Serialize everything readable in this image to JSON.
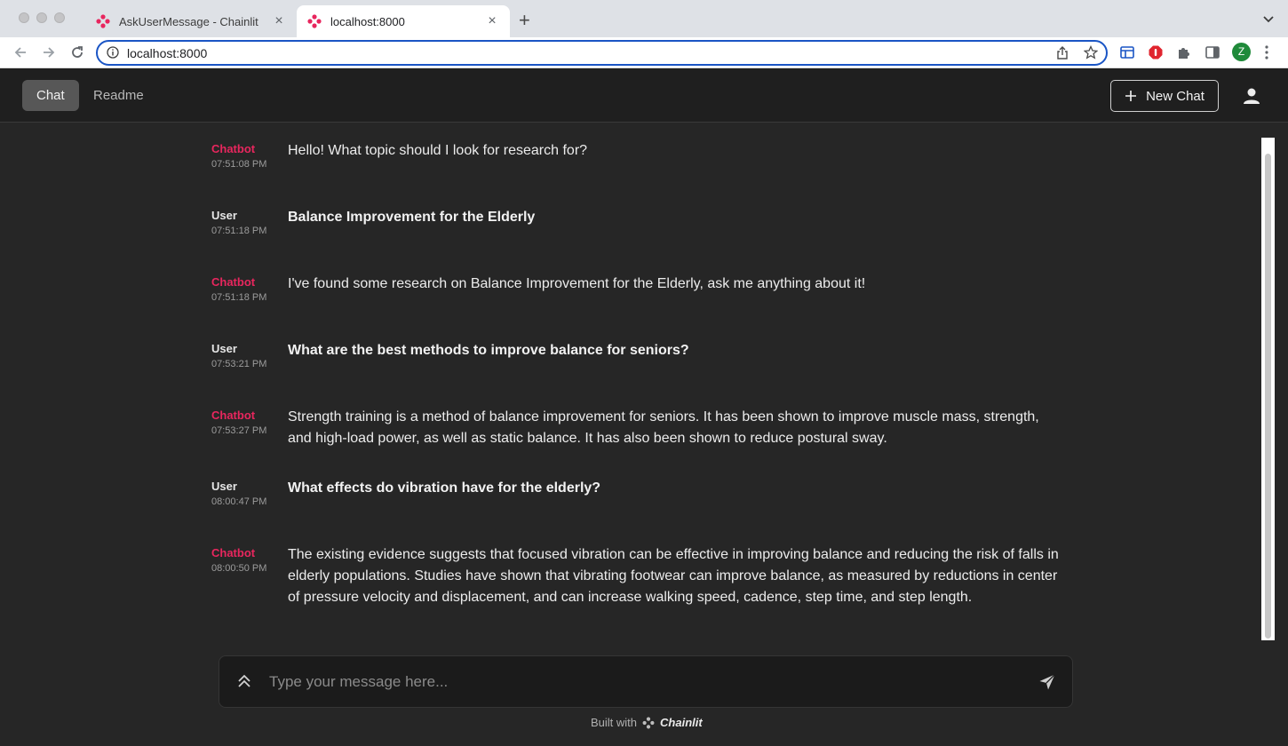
{
  "browser": {
    "tabs": [
      {
        "title": "AskUserMessage - Chainlit",
        "active": false
      },
      {
        "title": "localhost:8000",
        "active": true
      }
    ],
    "url": "localhost:8000",
    "profile_initial": "Z"
  },
  "header": {
    "nav": [
      "Chat",
      "Readme"
    ],
    "new_chat_label": "New Chat"
  },
  "messages": [
    {
      "author": "Chatbot",
      "time": "07:51:08 PM",
      "text": "Hello! What topic should I look for research for?"
    },
    {
      "author": "User",
      "time": "07:51:18 PM",
      "text": "Balance Improvement for the Elderly"
    },
    {
      "author": "Chatbot",
      "time": "07:51:18 PM",
      "text": "I've found some research on Balance Improvement for the Elderly, ask me anything about it!"
    },
    {
      "author": "User",
      "time": "07:53:21 PM",
      "text": "What are the best methods to improve balance for seniors?"
    },
    {
      "author": "Chatbot",
      "time": "07:53:27 PM",
      "text": "Strength training is a method of balance improvement for seniors. It has been shown to improve muscle mass, strength, and high-load power, as well as static balance. It has also been shown to reduce postural sway."
    },
    {
      "author": "User",
      "time": "08:00:47 PM",
      "text": "What effects do vibration have for the elderly?"
    },
    {
      "author": "Chatbot",
      "time": "08:00:50 PM",
      "text": "The existing evidence suggests that focused vibration can be effective in improving balance and reducing the risk of falls in elderly populations. Studies have shown that vibrating footwear can improve balance, as measured by reductions in center of pressure velocity and displacement, and can increase walking speed, cadence, step time, and step length."
    }
  ],
  "composer": {
    "placeholder": "Type your message here...",
    "value": ""
  },
  "footer": {
    "built_with": "Built with",
    "brand": "Chainlit"
  },
  "colors": {
    "accent": "#e8265e",
    "background": "#262626",
    "header": "#1f1f1f"
  }
}
